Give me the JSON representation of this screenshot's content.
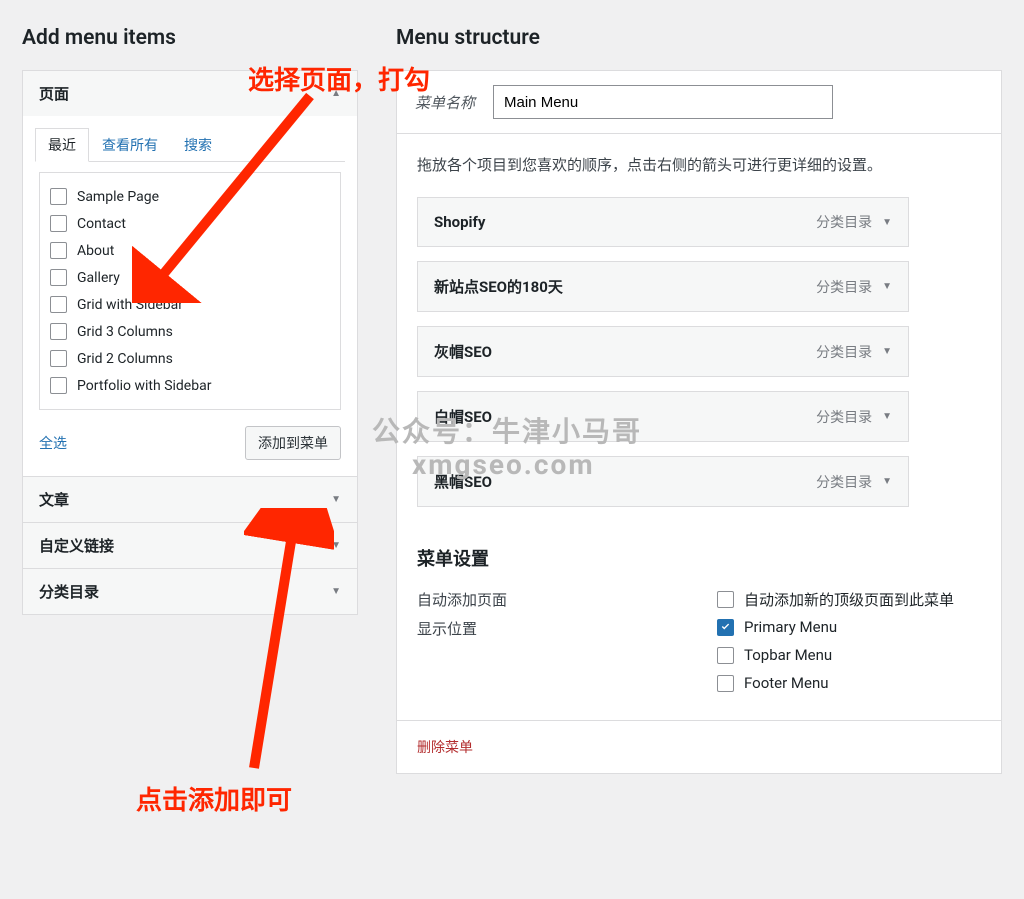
{
  "left": {
    "title": "Add menu items",
    "sections": {
      "pages": {
        "header": "页面",
        "tabs": [
          "最近",
          "查看所有",
          "搜索"
        ],
        "items": [
          "Sample Page",
          "Contact",
          "About",
          "Gallery",
          "Grid with Sidebar",
          "Grid 3 Columns",
          "Grid 2 Columns",
          "Portfolio with Sidebar"
        ],
        "select_all": "全选",
        "add_btn": "添加到菜单"
      },
      "posts": "文章",
      "custom": "自定义链接",
      "cats": "分类目录"
    }
  },
  "right": {
    "title": "Menu structure",
    "name_label": "菜单名称",
    "name_value": "Main Menu",
    "desc": "拖放各个项目到您喜欢的顺序，点击右侧的箭头可进行更详细的设置。",
    "type_label": "分类目录",
    "items": [
      "Shopify",
      "新站点SEO的180天",
      "灰帽SEO",
      "白帽SEO",
      "黑帽SEO"
    ],
    "settings": {
      "header": "菜单设置",
      "auto_label": "自动添加页面",
      "auto_option": "自动添加新的顶级页面到此菜单",
      "loc_label": "显示位置",
      "locations": [
        "Primary Menu",
        "Topbar Menu",
        "Footer Menu"
      ]
    },
    "delete": "删除菜单"
  },
  "annotations": {
    "top": "选择页面，打勾",
    "bottom": "点击添加即可"
  },
  "watermark": {
    "line1": "公众号：牛津小马哥",
    "line2": "xmgseo.com"
  }
}
